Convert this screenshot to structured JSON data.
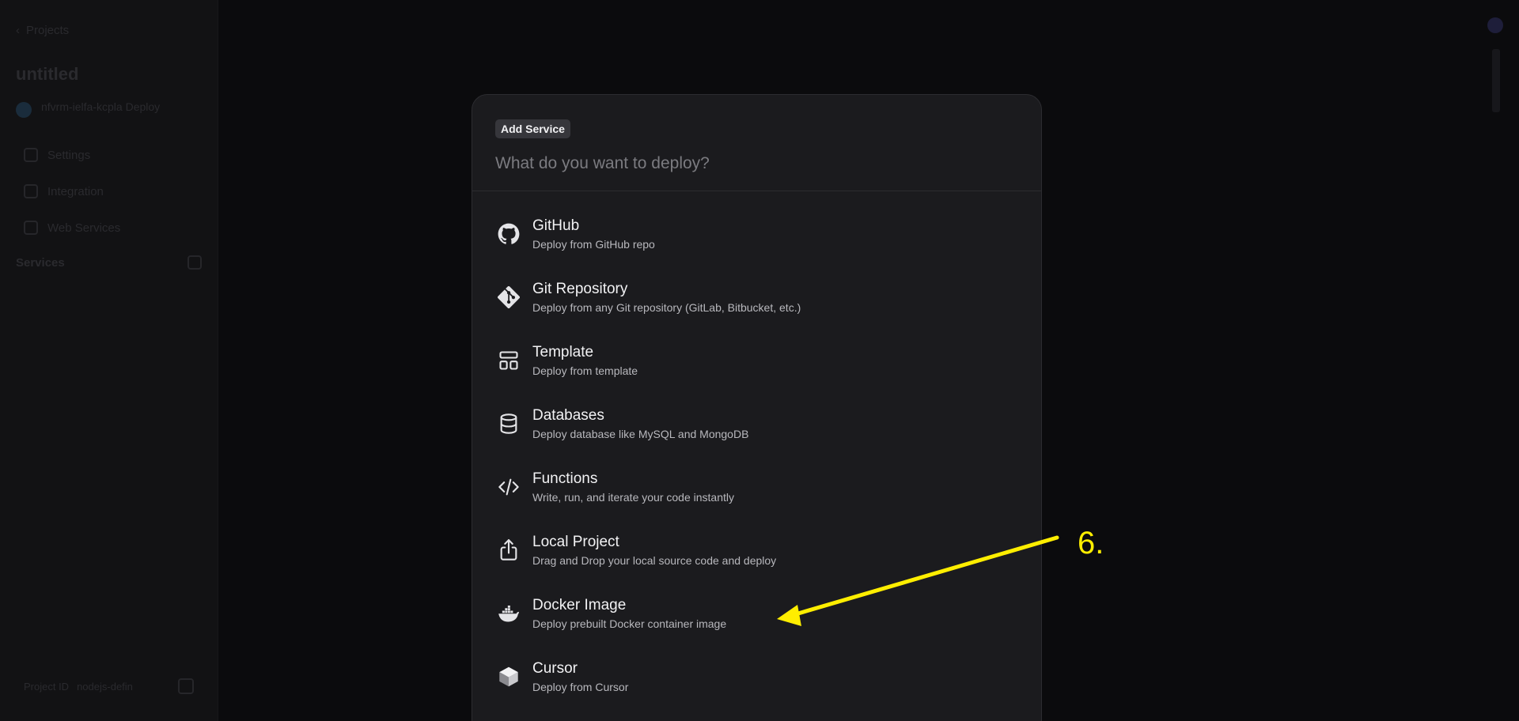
{
  "background": {
    "sidebar": {
      "back_link": "Projects",
      "project_title": "untitled",
      "project_meta": "nfvrm-ielfa-kcpla Deploy",
      "nav_items": [
        {
          "label": "Settings",
          "icon": "gear-icon"
        },
        {
          "label": "Integration",
          "icon": "link-icon"
        },
        {
          "label": "Web Services",
          "icon": "grid-icon"
        }
      ],
      "services_header": "Services",
      "footer_label": "Project ID",
      "footer_value": "nodejs-defin"
    }
  },
  "modal": {
    "badge": "Add Service",
    "search_placeholder": "What do you want to deploy?",
    "items": [
      {
        "title": "GitHub",
        "desc": "Deploy from GitHub repo",
        "icon": "github-icon"
      },
      {
        "title": "Git Repository",
        "desc": "Deploy from any Git repository (GitLab, Bitbucket, etc.)",
        "icon": "git-icon"
      },
      {
        "title": "Template",
        "desc": "Deploy from template",
        "icon": "template-icon"
      },
      {
        "title": "Databases",
        "desc": "Deploy database like MySQL and MongoDB",
        "icon": "database-icon"
      },
      {
        "title": "Functions",
        "desc": "Write, run, and iterate your code instantly",
        "icon": "code-icon"
      },
      {
        "title": "Local Project",
        "desc": "Drag and Drop your local source code and deploy",
        "icon": "upload-icon"
      },
      {
        "title": "Docker Image",
        "desc": "Deploy prebuilt Docker container image",
        "icon": "docker-icon"
      },
      {
        "title": "Cursor",
        "desc": "Deploy from Cursor",
        "icon": "cursor-icon"
      }
    ]
  },
  "annotation": {
    "step_label": "6.",
    "color": "#ffee00"
  },
  "colors": {
    "modal_bg": "#1b1b1e",
    "page_bg": "#0d0d0f",
    "title_text": "#f2f2f4",
    "desc_text": "#b8b8bd"
  }
}
